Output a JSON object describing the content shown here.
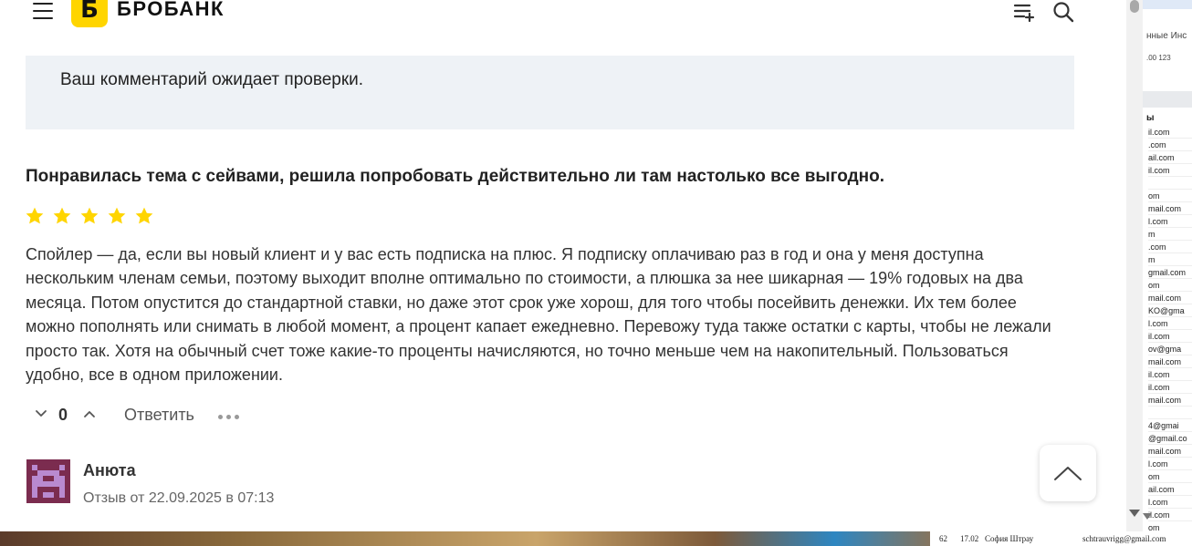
{
  "header": {
    "logo_letter": "Б",
    "logo_text": "БРОБАНК",
    "brand_color": "#FFD500"
  },
  "notice": {
    "text": "Ваш комментарий ожидает проверки."
  },
  "review": {
    "title": "Понравилась тема с сейвами, решила попробовать действительно ли там настолько все выгодно.",
    "rating": 5,
    "rating_max": 5,
    "star_color": "#FFD500",
    "body": "Спойлер — да, если вы новый клиент и у вас есть подписка на плюс. Я подписку оплачиваю раз в год и она у меня доступна нескольким членам семьи, поэтому выходит вполне оптимально по стоимости, а плюшка за нее шикарная — 19% годовых на два месяца. Потом опустится до стандартной ставки, но даже этот срок уже хорош, для того чтобы посейвить денежки. Их тем более можно пополнять или снимать в любой момент, а процент капает ежедневно. Перевожу туда также остатки с карты, чтобы не лежали просто так. Хотя на обычный счет тоже какие-то проценты начисляются, но точно меньше чем на накопительный. Пользоваться удобно, все в одном приложении.",
    "vote_count": "0",
    "reply_label": "Ответить"
  },
  "next_review": {
    "author": "Анюта",
    "date": "Отзыв от 22.09.2025 в 07:13",
    "avatar_color": "#7B2C4F"
  },
  "background_sheet": {
    "menu_text": "нные   Инс",
    "toolbar_text": ".00   123",
    "header_text": "ы",
    "cells": [
      "il.com",
      ".com",
      "ail.com",
      "il.com",
      "",
      "om",
      "mail.com",
      "l.com",
      "m",
      ".com",
      "m",
      "gmail.com",
      "om",
      "mail.com",
      "KO@gma",
      "l.com",
      "il.com",
      "ov@gma",
      "mail.com",
      "il.com",
      "il.com",
      "mail.com",
      "",
      "4@gmai",
      "@gmail.co",
      "mail.com",
      "l.com",
      "om",
      "ail.com",
      "l.com",
      "il.com",
      "om"
    ],
    "bottom_row": {
      "row_number": "62",
      "value": "17.02",
      "name": "София Штрау",
      "email": "schtrauvrigg@gmail.com"
    }
  }
}
